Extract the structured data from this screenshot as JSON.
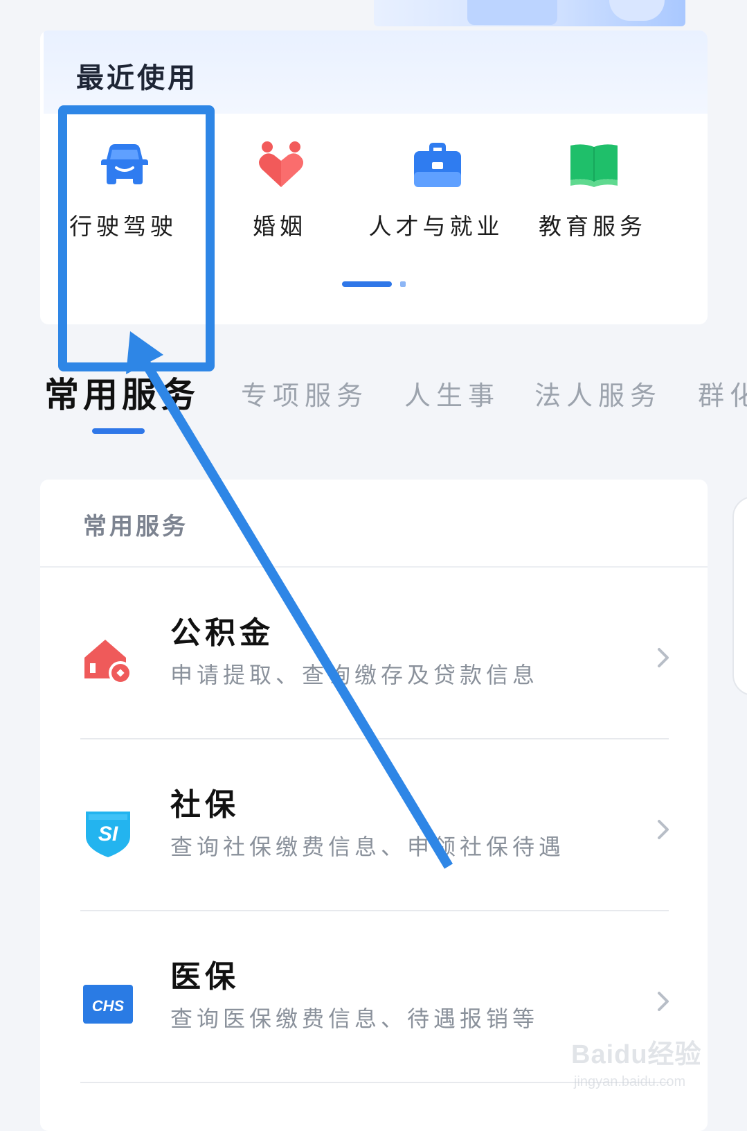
{
  "recent": {
    "title": "最近使用",
    "items": [
      {
        "label": "行驶驾驶",
        "icon": "car-icon"
      },
      {
        "label": "婚姻",
        "icon": "heart-icon"
      },
      {
        "label": "人才与就业",
        "icon": "briefcase-icon"
      },
      {
        "label": "教育服务",
        "icon": "book-icon"
      }
    ],
    "pager": {
      "active_page": 1,
      "pages": 2
    }
  },
  "tabs": [
    "常用服务",
    "专项服务",
    "人生事",
    "法人服务",
    "群化"
  ],
  "services": {
    "title": "常用服务",
    "items": [
      {
        "name": "公积金",
        "desc": "申请提取、查询缴存及贷款信息",
        "icon": "house-coin-icon"
      },
      {
        "name": "社保",
        "desc": "查询社保缴费信息、申领社保待遇",
        "icon": "si-shield-icon"
      },
      {
        "name": "医保",
        "desc": "查询医保缴费信息、待遇报销等",
        "icon": "chs-icon"
      }
    ]
  },
  "colors": {
    "accent": "#2f77e8",
    "annotation": "#2e86e6",
    "car": "#2f7cf0",
    "heart": "#f25a5a",
    "briefcase": "#2f7cf0",
    "book": "#1fbf6a",
    "house": "#ef5a5a",
    "si": "#23b4ef",
    "chs": "#2a7be4"
  },
  "watermark": {
    "logo": "Baidu经验",
    "url": "jingyan.baidu.com"
  }
}
